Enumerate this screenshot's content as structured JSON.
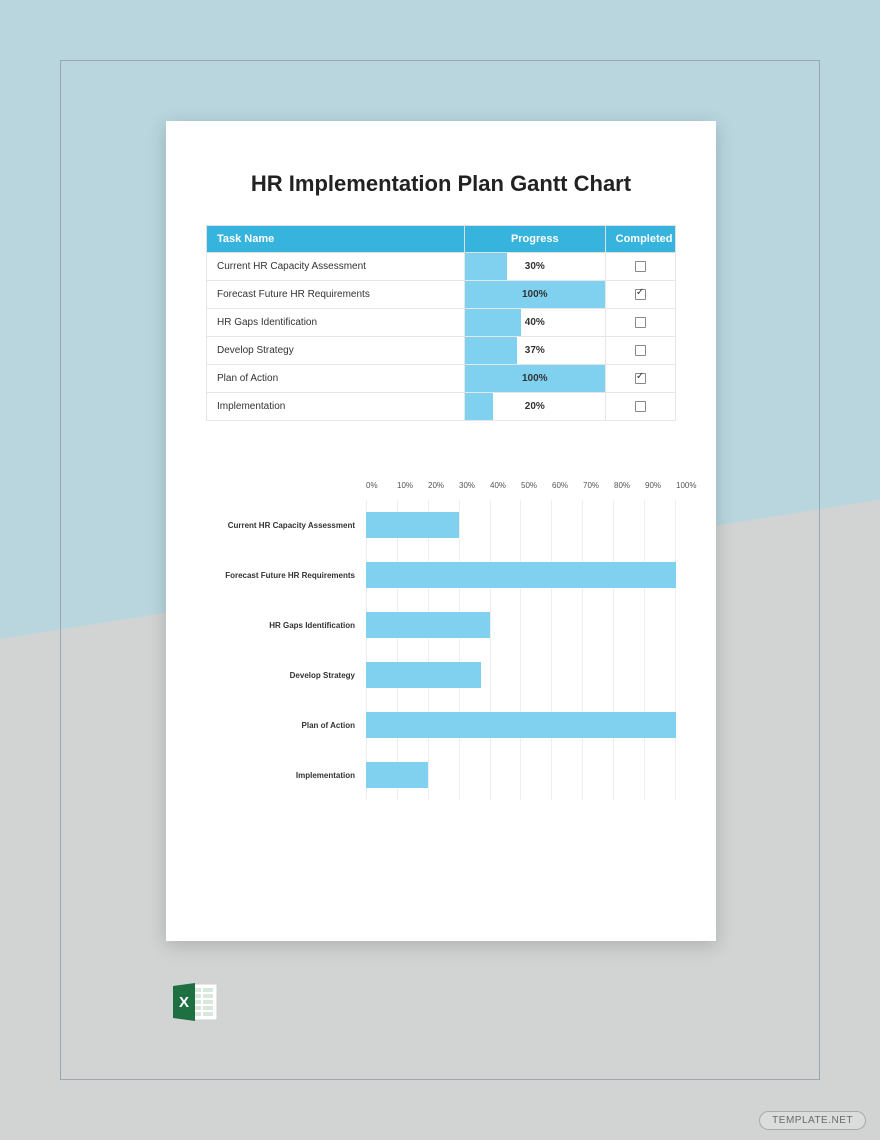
{
  "title": "HR Implementation Plan Gantt Chart",
  "table": {
    "headers": {
      "task": "Task Name",
      "progress": "Progress",
      "completed": "Completed"
    },
    "rows": [
      {
        "task": "Current HR Capacity Assessment",
        "progress": 30,
        "progress_label": "30%",
        "completed": false
      },
      {
        "task": "Forecast Future HR Requirements",
        "progress": 100,
        "progress_label": "100%",
        "completed": true
      },
      {
        "task": "HR Gaps Identification",
        "progress": 40,
        "progress_label": "40%",
        "completed": false
      },
      {
        "task": "Develop Strategy",
        "progress": 37,
        "progress_label": "37%",
        "completed": false
      },
      {
        "task": "Plan of Action",
        "progress": 100,
        "progress_label": "100%",
        "completed": true
      },
      {
        "task": "Implementation",
        "progress": 20,
        "progress_label": "20%",
        "completed": false
      }
    ]
  },
  "chart_data": {
    "type": "bar",
    "orientation": "horizontal",
    "categories": [
      "Current HR Capacity Assessment",
      "Forecast Future HR Requirements",
      "HR Gaps Identification",
      "Develop Strategy",
      "Plan of Action",
      "Implementation"
    ],
    "values": [
      30,
      100,
      40,
      37,
      100,
      20
    ],
    "xlabel": "",
    "ylabel": "",
    "xlim": [
      0,
      100
    ],
    "ticks": [
      "0%",
      "10%",
      "20%",
      "30%",
      "40%",
      "50%",
      "60%",
      "70%",
      "80%",
      "90%",
      "100%"
    ],
    "bar_color": "#7fd1ef"
  },
  "watermark": "TEMPLATE.NET",
  "file_icon": "excel-icon"
}
